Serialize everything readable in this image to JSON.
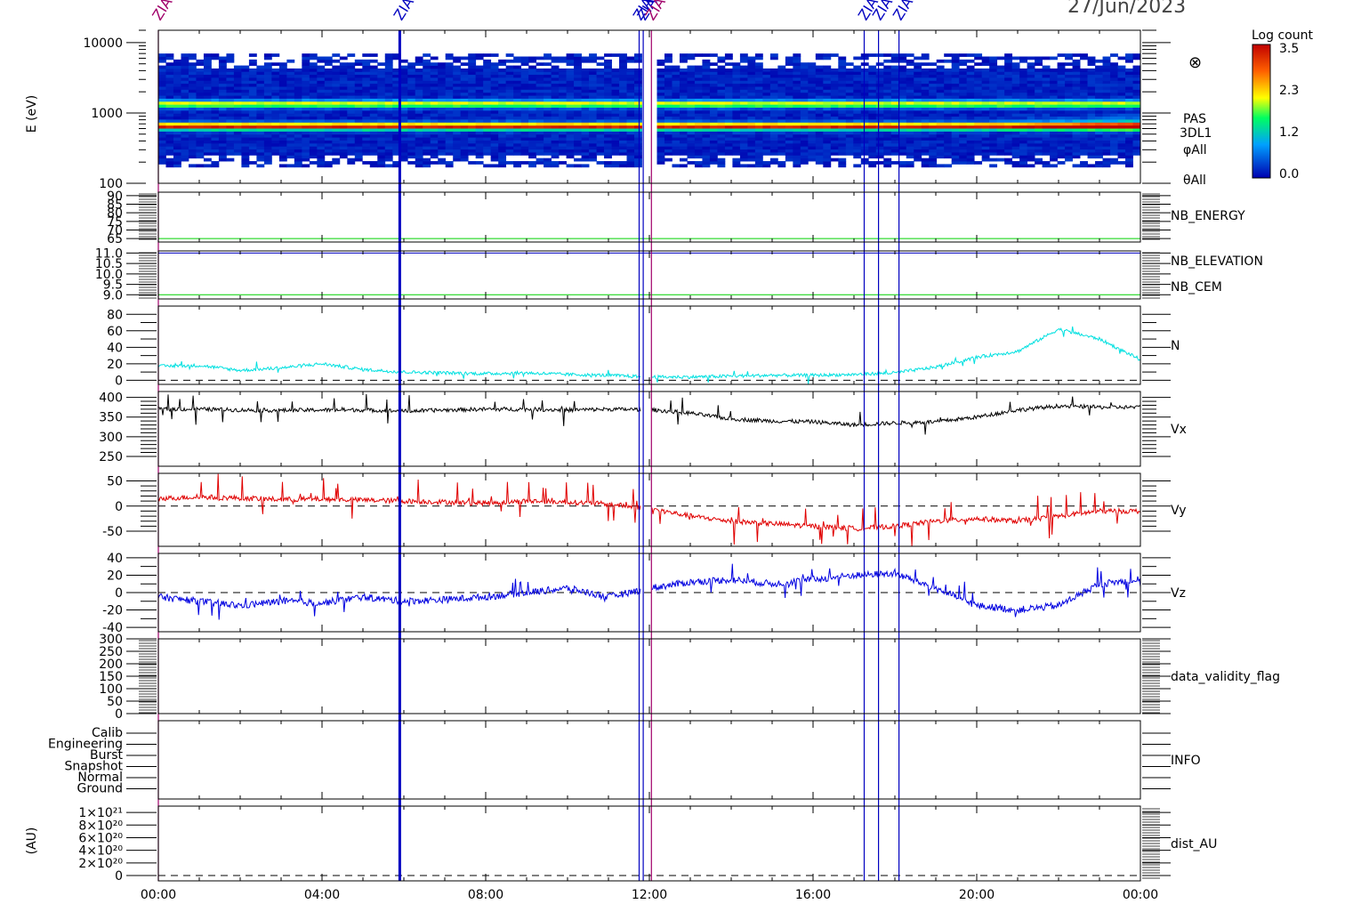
{
  "header": {
    "date": "27/Jun/2023"
  },
  "colorbar": {
    "title": "Log count",
    "ticks": [
      "3.5",
      "2.3",
      "1.2",
      "0.0"
    ]
  },
  "chart_data": [
    {
      "type": "heatmap",
      "panel": "spectrogram",
      "ylabel": "E (eV)",
      "yscale": "log",
      "yticks": [
        "10000",
        "1000",
        "100"
      ],
      "ylim": [
        100,
        15000
      ],
      "side_labels": [
        "PAS",
        "3DL1",
        "φAll",
        "θAll"
      ],
      "bands_eV": [
        {
          "center": 650,
          "level": 3.2
        },
        {
          "center": 1350,
          "level": 2.0
        }
      ],
      "colorbar_range": [
        0.0,
        3.5
      ]
    },
    {
      "type": "line",
      "panel": "nb-energy",
      "yticks": [
        "90",
        "85",
        "80",
        "75",
        "70",
        "65"
      ],
      "ylim": [
        63,
        92
      ],
      "series": [
        {
          "name": "NB_ENERGY",
          "color": "#00d000",
          "values": [
            65,
            65
          ]
        }
      ]
    },
    {
      "type": "line",
      "panel": "nb-elevation-cem",
      "yticks": [
        "11.0",
        "10.5",
        "10.0",
        "9.5",
        "9.0"
      ],
      "ylim": [
        8.8,
        11.1
      ],
      "series": [
        {
          "name": "NB_ELEVATION",
          "color": "#00d000",
          "values": [
            9.0,
            9.0
          ]
        },
        {
          "name": "NB_CEM",
          "color": "#0000c0",
          "values": [
            11.0,
            11.0
          ]
        }
      ]
    },
    {
      "type": "line",
      "panel": "density",
      "yticks": [
        "80",
        "60",
        "40",
        "20",
        "0"
      ],
      "ylim": [
        -5,
        90
      ],
      "series": [
        {
          "name": "N",
          "color": "#00e0e0",
          "x": [
            0,
            1,
            2,
            3,
            4,
            5,
            6,
            7,
            8,
            9,
            10,
            11,
            12,
            13,
            14,
            15,
            16,
            17,
            18,
            19,
            20,
            21,
            22,
            23,
            24
          ],
          "values": [
            17,
            18,
            12,
            15,
            20,
            13,
            10,
            9,
            8,
            9,
            7,
            6,
            4,
            4,
            5,
            6,
            6,
            7,
            9,
            16,
            28,
            35,
            62,
            50,
            25
          ]
        }
      ]
    },
    {
      "type": "line",
      "panel": "vx",
      "yticks": [
        "400",
        "350",
        "300",
        "250"
      ],
      "ylim": [
        225,
        415
      ],
      "series": [
        {
          "name": "Vx",
          "color": "#000000",
          "x": [
            0,
            1,
            2,
            3,
            4,
            5,
            6,
            7,
            8,
            9,
            10,
            11,
            12,
            13,
            14,
            15,
            16,
            17,
            18,
            19,
            20,
            21,
            22,
            23,
            24
          ],
          "values": [
            370,
            370,
            368,
            367,
            368,
            368,
            365,
            368,
            370,
            370,
            368,
            370,
            369,
            360,
            345,
            340,
            338,
            330,
            335,
            338,
            350,
            368,
            378,
            375,
            375
          ]
        }
      ]
    },
    {
      "type": "line",
      "panel": "vy",
      "yticks": [
        "50",
        "0",
        "-50"
      ],
      "ylim": [
        -80,
        65
      ],
      "series": [
        {
          "name": "Vy",
          "color": "#e00000",
          "x": [
            0,
            1,
            2,
            3,
            4,
            5,
            6,
            7,
            8,
            9,
            10,
            11,
            12,
            13,
            14,
            15,
            16,
            17,
            18,
            19,
            20,
            21,
            22,
            23,
            24
          ],
          "values": [
            15,
            18,
            16,
            13,
            14,
            12,
            10,
            8,
            6,
            10,
            8,
            4,
            -5,
            -20,
            -30,
            -35,
            -40,
            -45,
            -40,
            -30,
            -25,
            -30,
            -20,
            -10,
            -10
          ]
        }
      ]
    },
    {
      "type": "line",
      "panel": "vz",
      "yticks": [
        "40",
        "20",
        "0",
        "-20",
        "-40"
      ],
      "ylim": [
        -45,
        45
      ],
      "series": [
        {
          "name": "Vz",
          "color": "#0000e0",
          "x": [
            0,
            1,
            2,
            3,
            4,
            5,
            6,
            7,
            8,
            9,
            10,
            11,
            12,
            13,
            14,
            15,
            16,
            17,
            18,
            19,
            20,
            21,
            22,
            23,
            24
          ],
          "values": [
            -5,
            -10,
            -15,
            -10,
            -12,
            -5,
            -10,
            -8,
            -5,
            0,
            5,
            -5,
            5,
            12,
            15,
            10,
            15,
            20,
            22,
            5,
            -15,
            -20,
            -15,
            10,
            15
          ]
        }
      ]
    },
    {
      "type": "line",
      "panel": "data-validity",
      "yticks": [
        "300",
        "250",
        "200",
        "150",
        "100",
        "50",
        "0"
      ],
      "ylim": [
        0,
        300
      ],
      "series": [
        {
          "name": "data_validity_flag",
          "values": []
        }
      ]
    },
    {
      "type": "line",
      "panel": "info",
      "yticks": [
        "Calib",
        "Engineering",
        "Burst",
        "Snapshot",
        "Normal",
        "Ground"
      ],
      "series": [
        {
          "name": "INFO",
          "values": []
        }
      ]
    },
    {
      "type": "line",
      "panel": "dist-au",
      "ylabel": "(AU)",
      "yticks": [
        "1×10²¹",
        "8×10²⁰",
        "6×10²⁰",
        "4×10²⁰",
        "2×10²⁰",
        "0"
      ],
      "ylim": [
        0,
        1.1e+21
      ],
      "series": [
        {
          "name": "dist_AU",
          "values": []
        }
      ]
    }
  ],
  "time_axis": {
    "ticks": [
      "00:00",
      "04:00",
      "08:00",
      "12:00",
      "16:00",
      "20:00",
      "00:00"
    ],
    "hours": [
      0,
      4,
      8,
      12,
      16,
      20,
      24
    ]
  },
  "markers": {
    "label": "ZIAS",
    "hours": [
      0.0,
      5.9,
      11.75,
      11.85,
      12.05,
      17.25,
      17.6,
      18.1
    ]
  }
}
